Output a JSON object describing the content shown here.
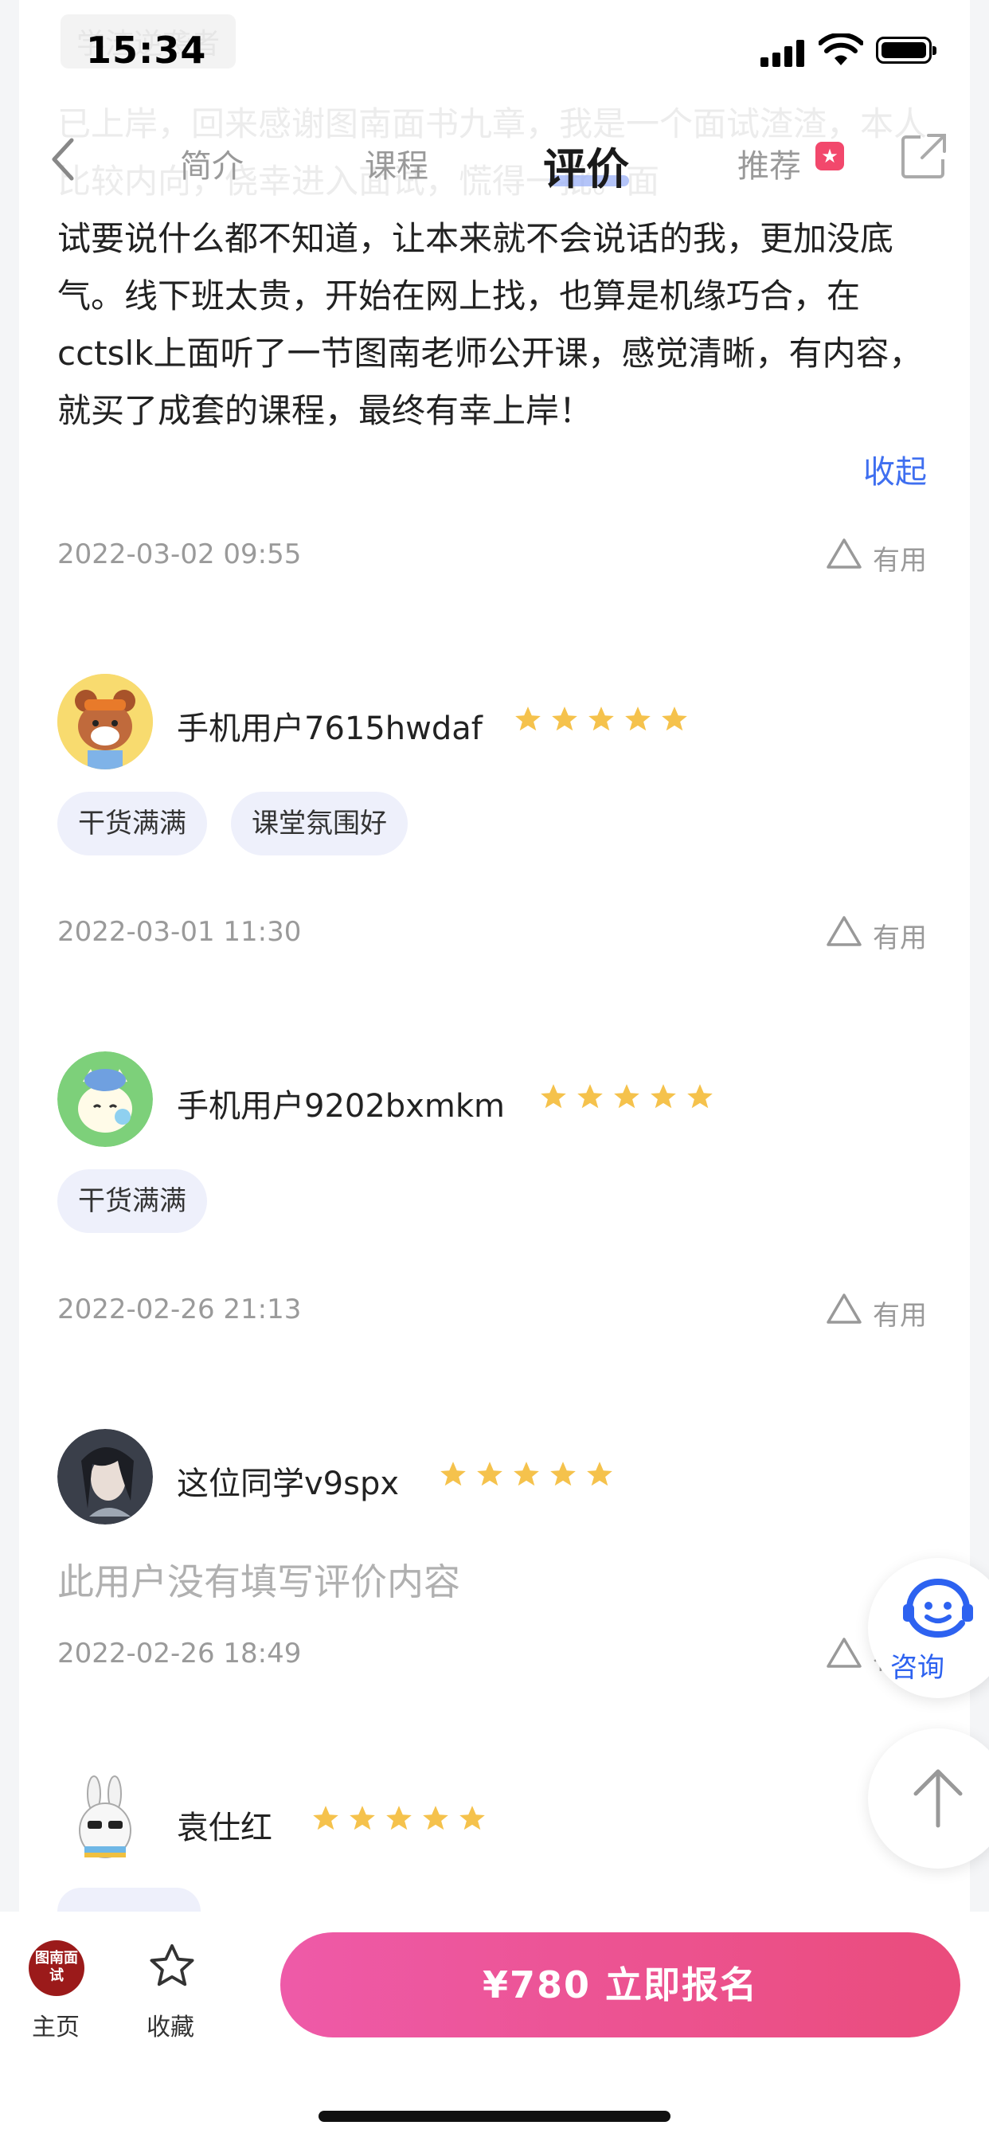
{
  "status_bar": {
    "time": "15:34"
  },
  "nav": {
    "tabs": [
      {
        "label": "简介"
      },
      {
        "label": "课程"
      },
      {
        "label": "评价"
      },
      {
        "label": "推荐"
      }
    ],
    "active_tab": "评价",
    "ghost_tag": "学渣逆袭者",
    "ghost_text": "已上岸，回来感谢图南面书九章，我是一个面试渣渣，本人比较内向，侥幸进入面试，慌得一批。面"
  },
  "first_review": {
    "text": "试要说什么都不知道，让本来就不会说话的我，更加没底气。线下班太贵，开始在网上找，也算是机缘巧合，在cctslk上面听了一节图南老师公开课，感觉清晰，有内容，就买了成套的课程，最终有幸上岸！",
    "collapse_label": "收起",
    "date": "2022-03-02 09:55",
    "useful_label": "有用"
  },
  "reviews": [
    {
      "user": "手机用户7615hwdaf",
      "rating": 5,
      "tags": [
        "干货满满",
        "课堂氛围好"
      ],
      "date": "2022-03-01 11:30",
      "useful_label": "有用"
    },
    {
      "user": "手机用户9202bxmkm",
      "rating": 5,
      "tags": [
        "干货满满"
      ],
      "date": "2022-02-26 21:13",
      "useful_label": "有用"
    },
    {
      "user": "这位同学v9spx",
      "rating": 5,
      "tags": [],
      "content": "此用户没有填写评价内容",
      "date": "2022-02-26 18:49",
      "useful_label": "有用"
    },
    {
      "user": "袁仕红",
      "rating": 5,
      "tags": []
    }
  ],
  "floating": {
    "consult_label": "咨询"
  },
  "bottom_bar": {
    "home_label": "主页",
    "home_logo_text": "图南面试",
    "favorite_label": "收藏",
    "cta_label": "¥780  立即报名"
  },
  "colors": {
    "accent_blue": "#3f6ff0",
    "star": "#f5c24c",
    "tag_bg": "#eef0fb",
    "cta_start": "#ee5aa8",
    "cta_end": "#ea4c7c"
  }
}
